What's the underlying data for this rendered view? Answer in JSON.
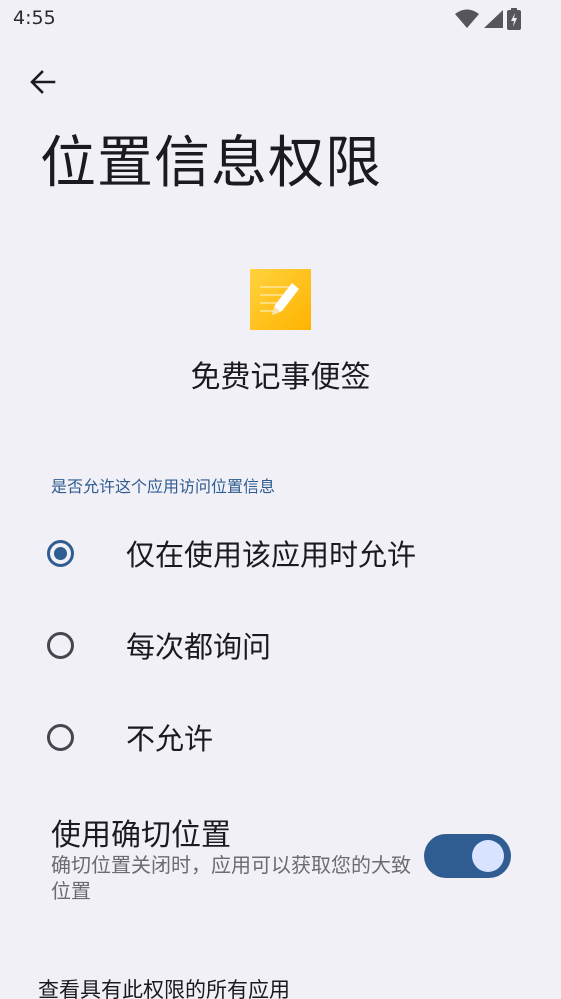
{
  "status_bar": {
    "time": "4:55",
    "icons": [
      "wifi-icon",
      "cellular-signal-icon",
      "battery-charging-icon"
    ]
  },
  "header": {
    "title": "位置信息权限"
  },
  "app": {
    "name": "免费记事便签",
    "icon": "notepad-pencil-icon"
  },
  "permission": {
    "section_label": "是否允许这个应用访问位置信息",
    "options": [
      {
        "label": "仅在使用该应用时允许",
        "selected": true
      },
      {
        "label": "每次都询问",
        "selected": false
      },
      {
        "label": "不允许",
        "selected": false
      }
    ]
  },
  "precise_location": {
    "title": "使用确切位置",
    "subtitle": "确切位置关闭时，应用可以获取您的大致位置",
    "enabled": true
  },
  "footer": {
    "all_apps_link": "查看具有此权限的所有应用"
  },
  "colors": {
    "background": "#f1f0f6",
    "accent": "#2f5c91",
    "toggle_thumb": "#d7e3ff"
  }
}
